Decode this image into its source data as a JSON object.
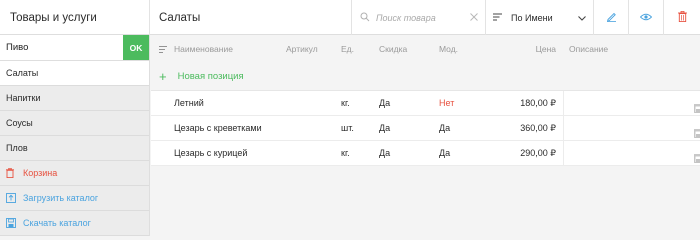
{
  "header": {
    "left_title": "Товары и услуги",
    "category_title": "Салаты",
    "search_placeholder": "Поиск товара",
    "sort_selected": "По Имени"
  },
  "sidebar": {
    "search_value": "Пиво",
    "ok_label": "OK",
    "categories": [
      "Салаты",
      "Напитки",
      "Соусы",
      "Плов"
    ],
    "actions": {
      "trash": "Корзина",
      "upload": "Загрузить каталог",
      "download": "Скачать каталог"
    }
  },
  "table": {
    "columns": {
      "name": "Наименование",
      "article": "Артикул",
      "unit": "Ед.",
      "discount": "Скидка",
      "modifier": "Мод.",
      "price": "Цена",
      "description": "Описание"
    },
    "new_position": "Новая позиция",
    "rows": [
      {
        "name": "Летний",
        "article": "",
        "unit": "кг.",
        "discount": "Да",
        "modifier": "Нет",
        "price": "180,00 ₽",
        "description": ""
      },
      {
        "name": "Цезарь с креветками",
        "article": "",
        "unit": "шт.",
        "discount": "Да",
        "modifier": "Да",
        "price": "360,00 ₽",
        "description": ""
      },
      {
        "name": "Цезарь с курицей",
        "article": "",
        "unit": "кг.",
        "discount": "Да",
        "modifier": "Да",
        "price": "290,00 ₽",
        "description": ""
      }
    ]
  },
  "colors": {
    "accent_green": "#4cbb5e",
    "danger_red": "#e7513f",
    "link_blue": "#4aa3df"
  },
  "icons": [
    "search-icon",
    "clear-icon",
    "sort-icon",
    "chevron-down-icon",
    "edit-icon",
    "eye-icon",
    "trash-icon",
    "list-icon",
    "plus-icon",
    "upload-icon",
    "download-icon",
    "save-icon"
  ]
}
